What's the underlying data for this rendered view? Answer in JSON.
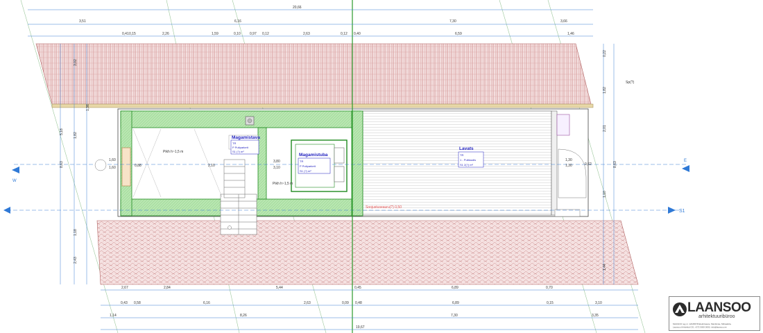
{
  "rooms": {
    "magamistava": {
      "name": "Magamistava",
      "info": [
        "TR",
        "P   Puitparkett",
        "S1    (?) m²"
      ]
    },
    "magamistuba": {
      "name": "Magamistuba",
      "info": [
        "TR",
        "P   Puitparkett",
        "S1        (?) m²"
      ]
    },
    "lavats": {
      "name": "Lavats",
      "info": [
        "TR",
        "1 - Puitlaudis",
        "S1  2(?) m²"
      ]
    }
  },
  "labels": {
    "pikh_left": "Pikh h~1,5 m",
    "pikh_right": "Pikh h~1,5 m",
    "red_note": "Soojustuseauru(?) 0,50",
    "sp_note": "Sp(?)",
    "axis_S1": "S1",
    "axis_E": "E",
    "axis_W": "W"
  },
  "dimensions": {
    "top_row1": [
      "20,66"
    ],
    "top_row2": [
      "3,51",
      "6,16",
      "7,30",
      "3,66"
    ],
    "top_row3": [
      "0,41",
      "0,15",
      "2,26",
      "1,59",
      "0,10",
      "0,97",
      "0,12",
      "2,63",
      "0,12",
      "0,40",
      "6,59",
      "1,46"
    ],
    "bot_row1": [
      "2,67",
      "2,84",
      "5,44",
      "0,45",
      "6,89",
      "0,70"
    ],
    "bot_row2": [
      "0,43",
      "0,58",
      "6,16",
      "2,63",
      "0,09",
      "0,48",
      "6,89",
      "0,15",
      "3,10"
    ],
    "bot_row3": [
      "1,14",
      "8,26",
      "7,30",
      "3,35"
    ],
    "bot_row4": [
      "19,67"
    ],
    "left_v": [
      "8,63",
      "3,02",
      "1,82",
      "1,18",
      "2,43",
      "5,18",
      "1,36"
    ],
    "right_v": [
      "0,22",
      "1,82",
      "8,63",
      "2,01",
      "1,10",
      "1,44"
    ],
    "inner": [
      "1,60",
      "1,60",
      "3,80",
      "3,10",
      "1,30",
      "1,30",
      "0,62",
      "0,88",
      "2,10"
    ]
  },
  "logo": {
    "name": "LAANSOO",
    "subtitle": "arhitektuuribüroo",
    "contact": [
      "MAASOO reg.nr. 12345678 Elektrisaare, Mardimäe, Mõisaküla,",
      "Laansoo Arhitektid OÜ, +372 5000 0000, info@laansoo.ee"
    ]
  },
  "colors": {
    "roof_tile": "#c77b7b",
    "wall_fill": "#b8e6b0",
    "wall_edge": "#1e8a1e",
    "dim_line": "#3a7fd5",
    "axis": "#3a7fd5",
    "room_text": "#1f1fbf",
    "red_note": "#e05050"
  }
}
